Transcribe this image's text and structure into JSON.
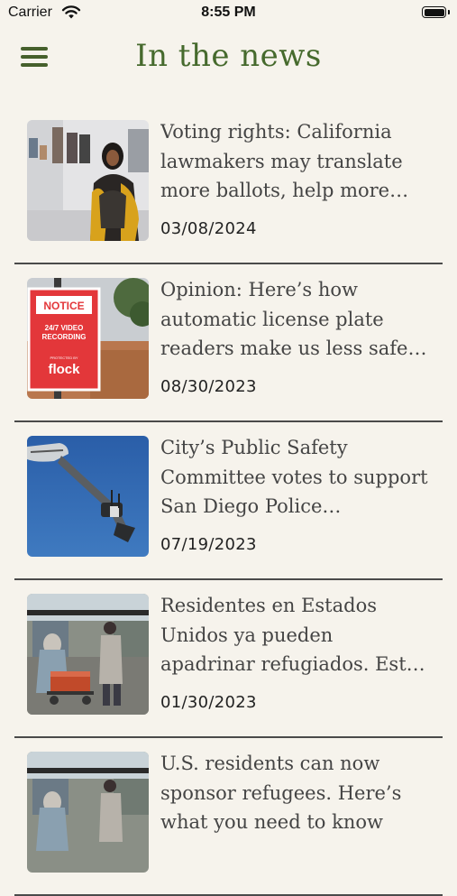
{
  "status_bar": {
    "carrier": "Carrier",
    "time": "8:55 PM",
    "icons": [
      "wifi-icon",
      "battery-icon"
    ]
  },
  "header": {
    "title": "In the news",
    "menu_icon": "hamburger-menu-icon",
    "accent_color": "#466a2d"
  },
  "articles": [
    {
      "headline": "Voting rights: California lawmakers may translate more ballots, help more non-English speakers vote",
      "date": "03/08/2024",
      "thumbnail": "woman-in-gallery-photo"
    },
    {
      "headline": "Opinion: Here’s how automatic license plate readers make us less safe and harm communities",
      "date": "08/30/2023",
      "thumbnail": "notice-sign-photo",
      "thumbnail_text": {
        "line1": "NOTICE",
        "line2": "24/7 VIDEO",
        "line3": "RECORDING",
        "line4": "PROTECTED BY",
        "line5": "flock"
      }
    },
    {
      "headline": "City’s Public Safety Committee votes to support San Diego Police surveillance technology",
      "date": "07/19/2023",
      "thumbnail": "streetlight-camera-photo"
    },
    {
      "headline": "Residentes en Estados Unidos ya pueden apadrinar refugiados. Esto es lo que necesitas saber",
      "date": "01/30/2023",
      "thumbnail": "market-stall-photo"
    },
    {
      "headline": "U.S. residents can now sponsor refugees. Here’s what you need to know",
      "date": "",
      "thumbnail": "market-stall-photo"
    }
  ]
}
